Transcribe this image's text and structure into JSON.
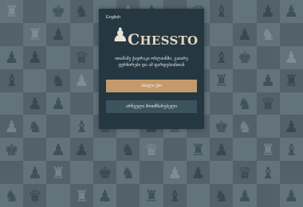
{
  "header": {
    "language_label": "English"
  },
  "logo": {
    "icon": "pawn-icon",
    "first_letter": "C",
    "rest": "HESSTO"
  },
  "tagline": "ითამაშე ჭადრაკი ონლაინში, გაიარე ტურნირები და ამ ფარდებიანთან",
  "buttons": {
    "new_game": "ახალი ეხი",
    "settings": "არჩეული მოთმწარებელი"
  },
  "colors": {
    "panel": "#253741",
    "primary_button": "#c49a6c",
    "secondary_button": "#3a535d",
    "board_light": "#63737b",
    "board_dark": "#53626a"
  }
}
